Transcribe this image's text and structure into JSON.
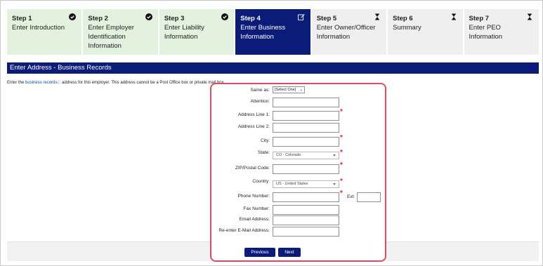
{
  "steps": [
    {
      "num": "Step 1",
      "name": "Enter Introduction",
      "status": "done",
      "icon": "check-circle-icon"
    },
    {
      "num": "Step 2",
      "name": "Enter Employer Identification Information",
      "status": "done",
      "icon": "check-circle-icon"
    },
    {
      "num": "Step 3",
      "name": "Enter Liability Information",
      "status": "done",
      "icon": "check-circle-icon"
    },
    {
      "num": "Step 4",
      "name": "Enter Business Information",
      "status": "active",
      "icon": "edit-icon"
    },
    {
      "num": "Step 5",
      "name": "Enter Owner/Officer Information",
      "status": "todo",
      "icon": "hourglass-icon"
    },
    {
      "num": "Step 6",
      "name": "Summary",
      "status": "todo",
      "icon": "hourglass-icon"
    },
    {
      "num": "Step 7",
      "name": "Enter PEO Information",
      "status": "todo",
      "icon": "hourglass-icon"
    }
  ],
  "section": {
    "title": "Enter Address - Business Records"
  },
  "instruction": {
    "before": "Enter the ",
    "link": "business records",
    "after": " address for this employer. This address cannot be a Post Office box or private mail box."
  },
  "form": {
    "same_as_label": "Same as:",
    "same_as_value": "[Select One]",
    "attention_label": "Attention:",
    "address1_label": "Address Line 1:",
    "address2_label": "Address Line 2:",
    "city_label": "City:",
    "state_label": "State:",
    "state_value": "CO - Colorado",
    "zip_label": "ZIP/Postal Code:",
    "country_label": "Country:",
    "country_value": "US - United States",
    "phone_label": "Phone Number:",
    "ext_label": "Ext:",
    "fax_label": "Fax Number:",
    "email_label": "Email Address:",
    "reemail_label": "Re-enter E-Mail Address:",
    "required_mark": "*"
  },
  "buttons": {
    "previous": "Previous",
    "next": "Next"
  },
  "colors": {
    "accent": "#0b1c78",
    "done": "#e3f2de",
    "todo": "#efefef",
    "highlight": "#e04c5b",
    "required": "#e4252c"
  }
}
